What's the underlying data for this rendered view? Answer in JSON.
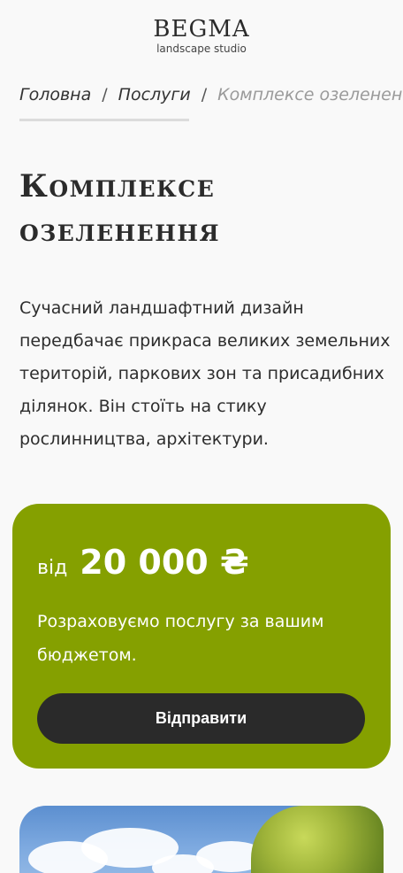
{
  "header": {
    "logo_title": "BEGMA",
    "logo_subtitle": "landscape studio"
  },
  "breadcrumb": {
    "items": [
      "Головна",
      "Послуги"
    ],
    "separator": "/",
    "current": "Комплексе озеленен"
  },
  "page": {
    "title": "Комплексе озеленення",
    "intro": "Сучасний ландшафтний дизайн передбачає прикраса великих земельних територій, паркових зон та присадибних ділянок. Він стоїть на стику рослинництва, архітектури."
  },
  "price_card": {
    "prefix": "від",
    "value": "20 000 ₴",
    "description": "Розраховуємо послугу за вашим бюджетом.",
    "button_label": "Відправити",
    "background": "#85a000",
    "button_color": "#2a2a2a"
  },
  "photo": {
    "icon": "landscape-photo"
  }
}
